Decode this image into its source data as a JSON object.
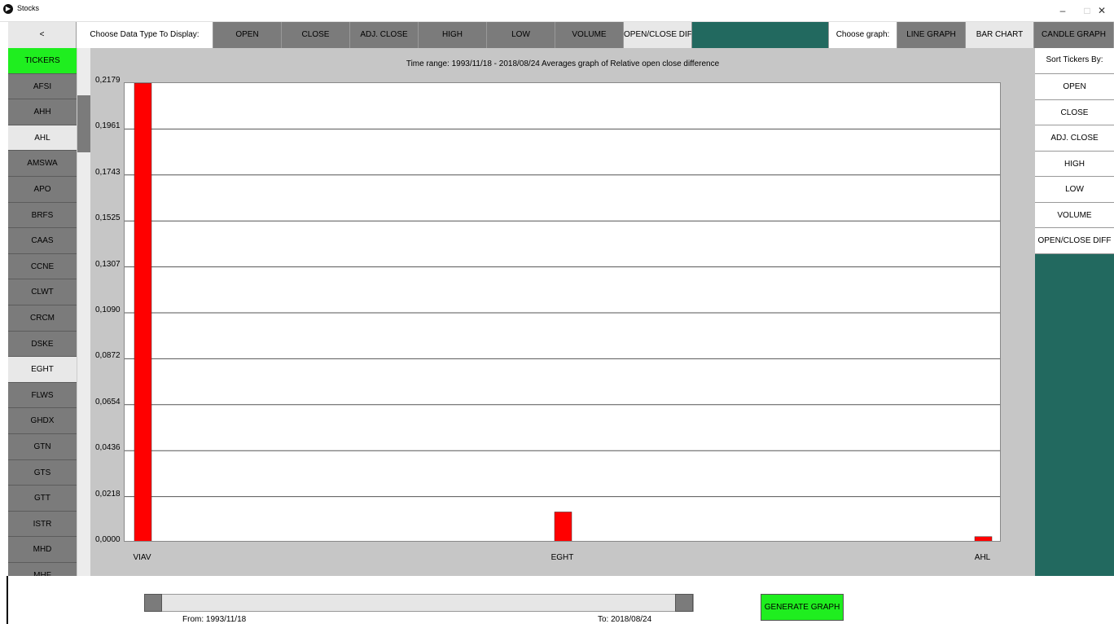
{
  "window": {
    "title": "Stocks",
    "controls": [
      "–",
      "□",
      "✕"
    ]
  },
  "topbar": {
    "back_label": "<",
    "data_type_label": "Choose Data Type To Display:",
    "data_types": [
      "OPEN",
      "CLOSE",
      "ADJ. CLOSE",
      "HIGH",
      "LOW",
      "VOLUME",
      "OPEN/CLOSE DIFF"
    ],
    "graph_label": "Choose graph:",
    "graph_types": [
      "LINE GRAPH",
      "BAR CHART",
      "CANDLE GRAPH"
    ]
  },
  "tickers": {
    "header": "TICKERS",
    "items": [
      "AFSI",
      "AHH",
      "AHL",
      "AMSWA",
      "APO",
      "BRFS",
      "CAAS",
      "CCNE",
      "CLWT",
      "CRCM",
      "DSKE",
      "EGHT",
      "FLWS",
      "GHDX",
      "GTN",
      "GTS",
      "GTT",
      "ISTR",
      "MHD",
      "MHF"
    ]
  },
  "sort": {
    "title": "Sort Tickers By:",
    "items": [
      "OPEN",
      "CLOSE",
      "ADJ. CLOSE",
      "HIGH",
      "LOW",
      "VOLUME",
      "OPEN/CLOSE DIFF"
    ]
  },
  "colors": {
    "bar": "#ff0000",
    "accent_green": "#1fee1f",
    "teal": "#22695f"
  },
  "chart_data": {
    "type": "bar",
    "title": "Time range: 1993/11/18 - 2018/08/24 Averages graph of Relative open close difference",
    "categories": [
      "VIAV",
      "EGHT",
      "AHL"
    ],
    "values": [
      0.2179,
      0.0145,
      0.0028
    ],
    "ylim": [
      0,
      0.2179
    ],
    "yticks": [
      "0,0000",
      "0,0218",
      "0,0436",
      "0,0654",
      "0,0872",
      "0,1090",
      "0,1307",
      "0,1525",
      "0,1743",
      "0,1961",
      "0,2179"
    ],
    "grid": true
  },
  "range": {
    "from_label": "From: 1993/11/18",
    "to_label": "To: 2018/08/24"
  },
  "generate_label": "GENERATE GRAPH"
}
